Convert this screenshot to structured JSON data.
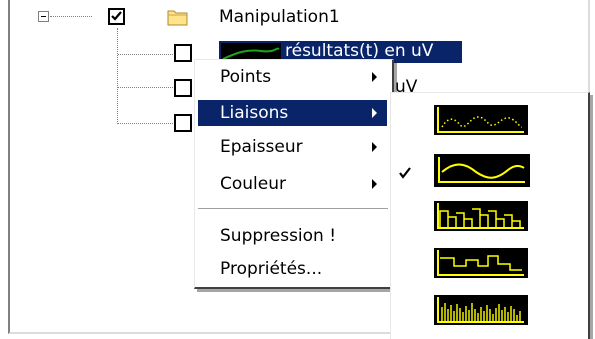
{
  "tree": {
    "root_label": "Manipulation1",
    "child1_label": "résultats(t) en uV",
    "child2_partial_label": "uV"
  },
  "context_menu": {
    "items": [
      {
        "label": "Points",
        "has_submenu": true
      },
      {
        "label": "Liaisons",
        "has_submenu": true,
        "highlighted": true
      },
      {
        "label": "Epaisseur",
        "has_submenu": true
      },
      {
        "label": "Couleur",
        "has_submenu": true
      },
      {
        "label": "Suppression !",
        "has_submenu": false
      },
      {
        "label": "Propriétés...",
        "has_submenu": false
      }
    ]
  },
  "submenu": {
    "options": [
      {
        "name": "dotted-curve-option",
        "checked": false
      },
      {
        "name": "smooth-curve-option",
        "checked": true
      },
      {
        "name": "step-bars-option",
        "checked": false
      },
      {
        "name": "step-line-option",
        "checked": false
      },
      {
        "name": "vertical-bars-option",
        "checked": false
      }
    ]
  },
  "colors": {
    "selection": "#0a246a",
    "curve_yellow": "#ffff00",
    "folder_yellow": "#ffe48a"
  }
}
